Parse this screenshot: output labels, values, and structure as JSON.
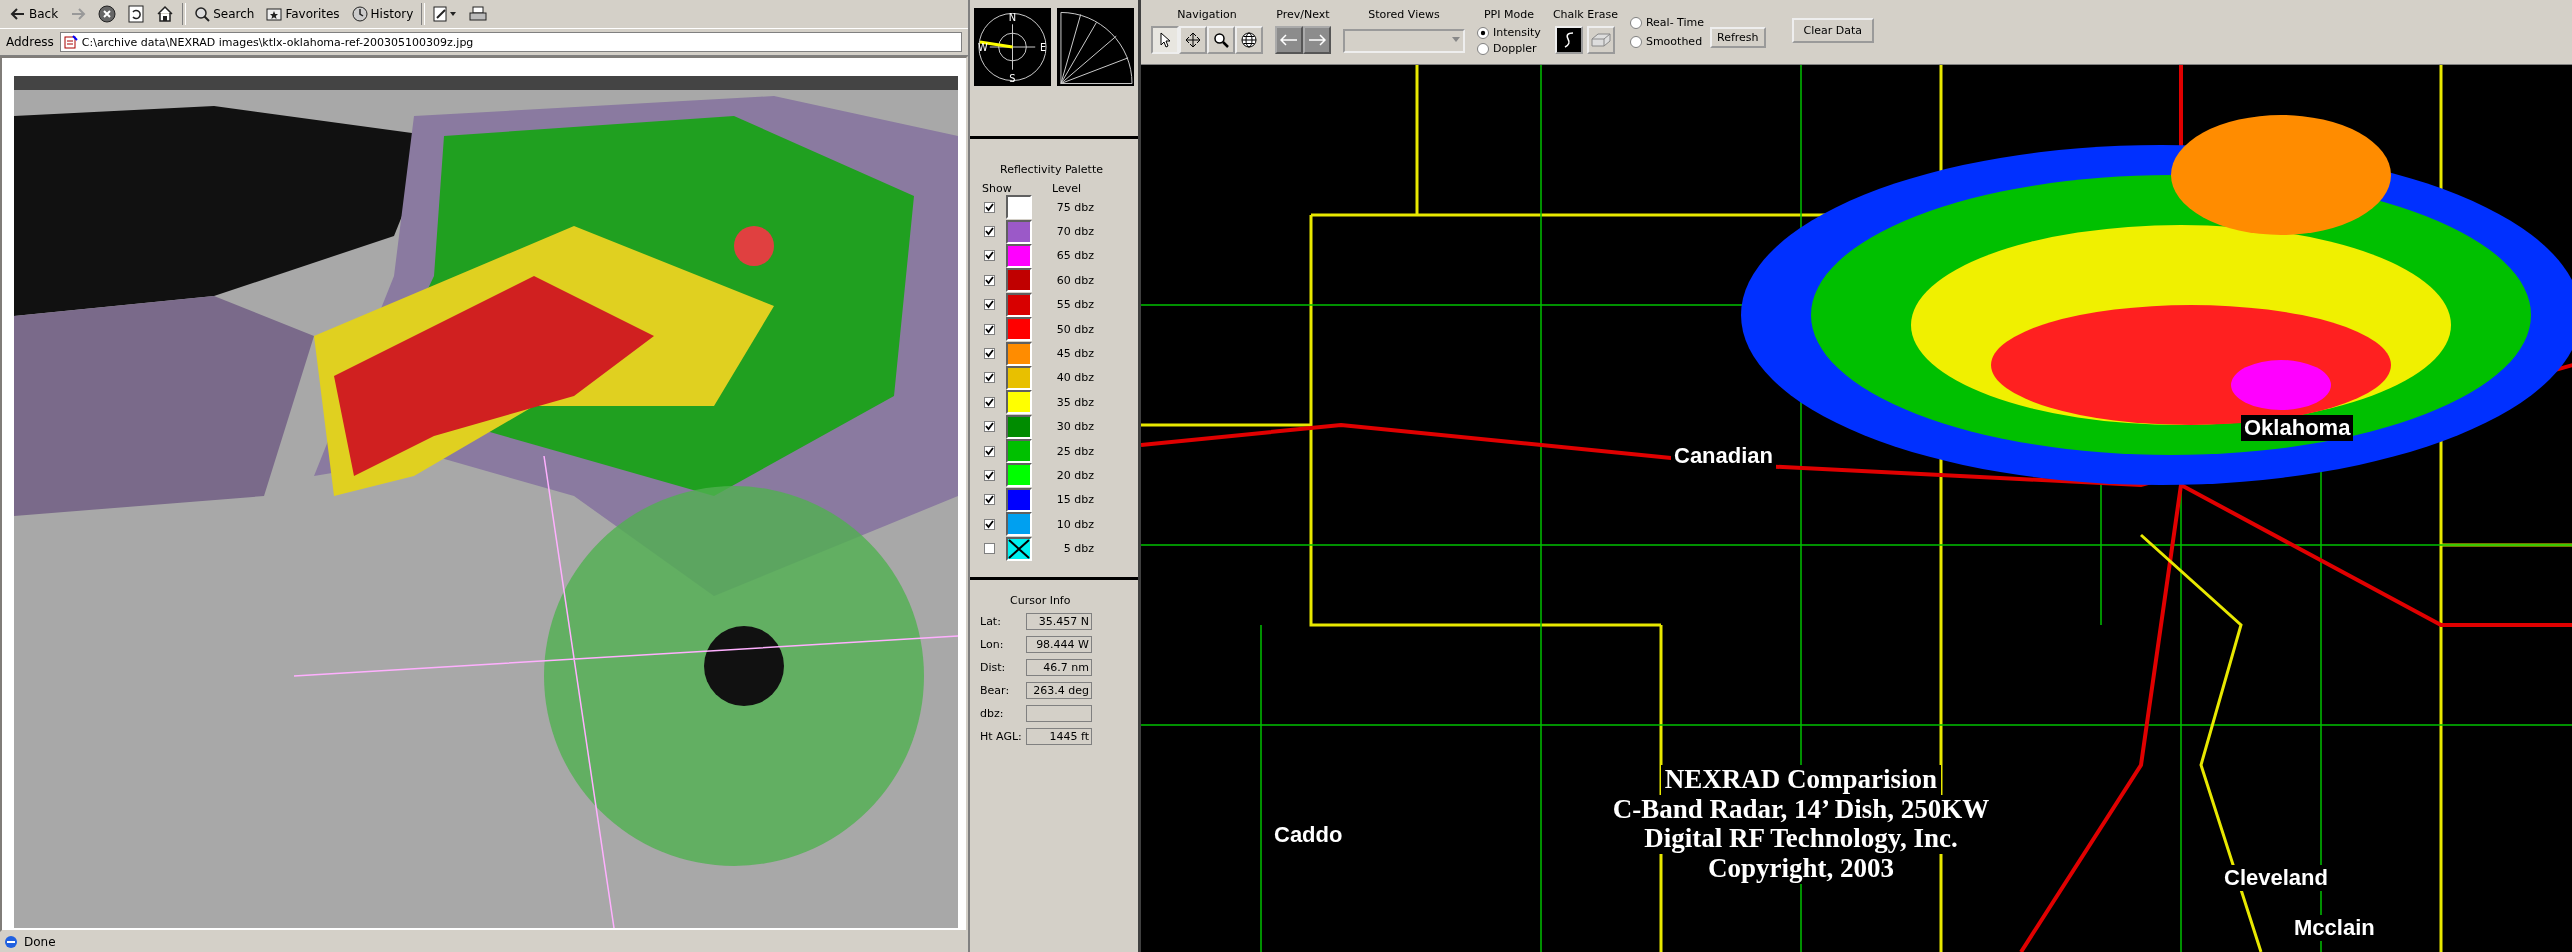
{
  "browser": {
    "toolbar": [
      {
        "kind": "back",
        "label": "Back",
        "disabled": false
      },
      {
        "kind": "forward",
        "disabled": true
      },
      {
        "kind": "stop",
        "disabled": false
      },
      {
        "kind": "refresh",
        "disabled": false
      },
      {
        "kind": "home",
        "disabled": false
      },
      {
        "kind": "search",
        "label": "Search",
        "disabled": false
      },
      {
        "kind": "favorites",
        "label": "Favorites",
        "disabled": false
      },
      {
        "kind": "history",
        "label": "History",
        "disabled": false
      },
      {
        "kind": "edit",
        "disabled": false
      },
      {
        "kind": "print",
        "disabled": false
      }
    ],
    "address": {
      "label": "Address",
      "value": "C:\\archive data\\NEXRAD images\\ktlx-oklahoma-ref-200305100309z.jpg"
    },
    "status_bar": {
      "text": "Done"
    }
  },
  "compass": {
    "north": "N",
    "east": "E",
    "south": "S",
    "west": "W"
  },
  "palette": {
    "title": "Reflectivity Palette",
    "show_header": "Show",
    "level_header": "Level",
    "levels": [
      {
        "label": "75 dbz",
        "color": "#ffffff",
        "checked": true
      },
      {
        "label": "70 dbz",
        "color": "#9b59c8",
        "checked": true
      },
      {
        "label": "65 dbz",
        "color": "#ff00ff",
        "checked": true
      },
      {
        "label": "60 dbz",
        "color": "#c00000",
        "checked": true
      },
      {
        "label": "55 dbz",
        "color": "#d80000",
        "checked": true
      },
      {
        "label": "50 dbz",
        "color": "#ff0000",
        "checked": true
      },
      {
        "label": "45 dbz",
        "color": "#ff8c00",
        "checked": true
      },
      {
        "label": "40 dbz",
        "color": "#e8c000",
        "checked": true
      },
      {
        "label": "35 dbz",
        "color": "#ffff00",
        "checked": true
      },
      {
        "label": "30 dbz",
        "color": "#008c00",
        "checked": true
      },
      {
        "label": "25 dbz",
        "color": "#00c000",
        "checked": true
      },
      {
        "label": "20 dbz",
        "color": "#00ff00",
        "checked": true
      },
      {
        "label": "15 dbz",
        "color": "#0000ff",
        "checked": true
      },
      {
        "label": "10 dbz",
        "color": "#00a0f0",
        "checked": true
      },
      {
        "label": "5 dbz",
        "color": "#00f0f0",
        "checked": false
      }
    ]
  },
  "cursor_info": {
    "title": "Cursor Info",
    "fields": [
      {
        "label": "Lat:",
        "value": "35.457 N"
      },
      {
        "label": "Lon:",
        "value": "98.444 W"
      },
      {
        "label": "Dist:",
        "value": "46.7 nm"
      },
      {
        "label": "Bear:",
        "value": "263.4 deg"
      },
      {
        "label": "dbz:"
      },
      {
        "label": "Ht AGL:",
        "value": "1445 ft"
      }
    ]
  },
  "toolbar": {
    "navigation": {
      "label": "Navigation",
      "tools": [
        {
          "kind": "pointer",
          "selected": true
        },
        {
          "kind": "pan",
          "selected": false
        },
        {
          "kind": "zoom",
          "selected": false
        },
        {
          "kind": "globe",
          "selected": false
        }
      ]
    },
    "prev_next": {
      "label": "Prev/Next",
      "buttons": [
        {
          "kind": "prev",
          "disabled": true
        },
        {
          "kind": "next",
          "disabled": true
        }
      ]
    },
    "stored_views": {
      "label": "Stored Views",
      "disabled": true
    },
    "ppi_mode": {
      "label": "PPI Mode",
      "options": [
        {
          "label": "Intensity",
          "selected": true
        },
        {
          "label": "Doppler",
          "selected": false
        }
      ]
    },
    "chalk_erase": {
      "label": "Chalk Erase",
      "tools": [
        {
          "kind": "chalk"
        },
        {
          "kind": "eraser"
        }
      ]
    },
    "display_mode": {
      "options": [
        {
          "label": "Real- Time",
          "selected": false
        },
        {
          "label": "Smoothed",
          "selected": false
        }
      ]
    },
    "refresh_button": "Refresh",
    "clear_button": "Clear Data"
  },
  "map": {
    "labels": [
      "Canadian",
      "Oklahoma",
      "Caddo",
      "Cleveland",
      "Mcclain"
    ],
    "caption": [
      "NEXRAD Comparision",
      "C-Band Radar, 14’ Dish, 250KW",
      "Digital RF Technology, Inc.",
      "Copyright, 2003"
    ]
  }
}
